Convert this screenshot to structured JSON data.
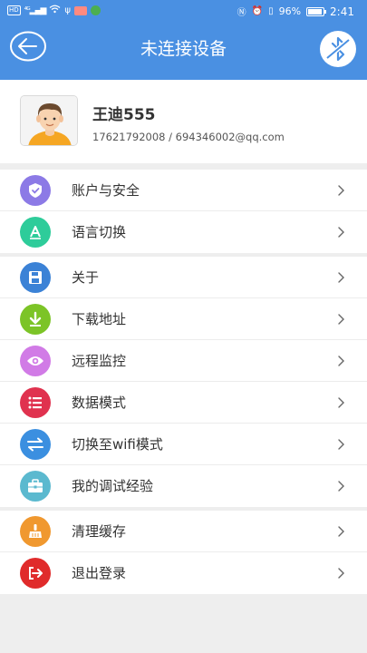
{
  "status_bar": {
    "left_indicators": "HD 4G",
    "battery_percent": "96%",
    "time": "2:41"
  },
  "header": {
    "title": "未连接设备"
  },
  "profile": {
    "name": "王迪555",
    "contact": "17621792008 / 694346002@qq.com"
  },
  "menu_groups": [
    [
      {
        "label": "账户与安全",
        "icon": "shield-icon",
        "color": "#8c7ae6"
      },
      {
        "label": "语言切换",
        "icon": "language-icon",
        "color": "#2ecc9a"
      }
    ],
    [
      {
        "label": "关于",
        "icon": "floppy-disk-icon",
        "color": "#3b82d6"
      },
      {
        "label": "下载地址",
        "icon": "download-icon",
        "color": "#7cc427"
      },
      {
        "label": "远程监控",
        "icon": "eye-icon",
        "color": "#d17be6"
      },
      {
        "label": "数据模式",
        "icon": "list-icon",
        "color": "#e0324f"
      },
      {
        "label": "切换至wifi模式",
        "icon": "swap-icon",
        "color": "#3b8fe0"
      },
      {
        "label": "我的调试经验",
        "icon": "toolbox-icon",
        "color": "#5bb9cf"
      }
    ],
    [
      {
        "label": "清理缓存",
        "icon": "broom-icon",
        "color": "#f0982f"
      },
      {
        "label": "退出登录",
        "icon": "logout-icon",
        "color": "#e02b2b"
      }
    ]
  ]
}
